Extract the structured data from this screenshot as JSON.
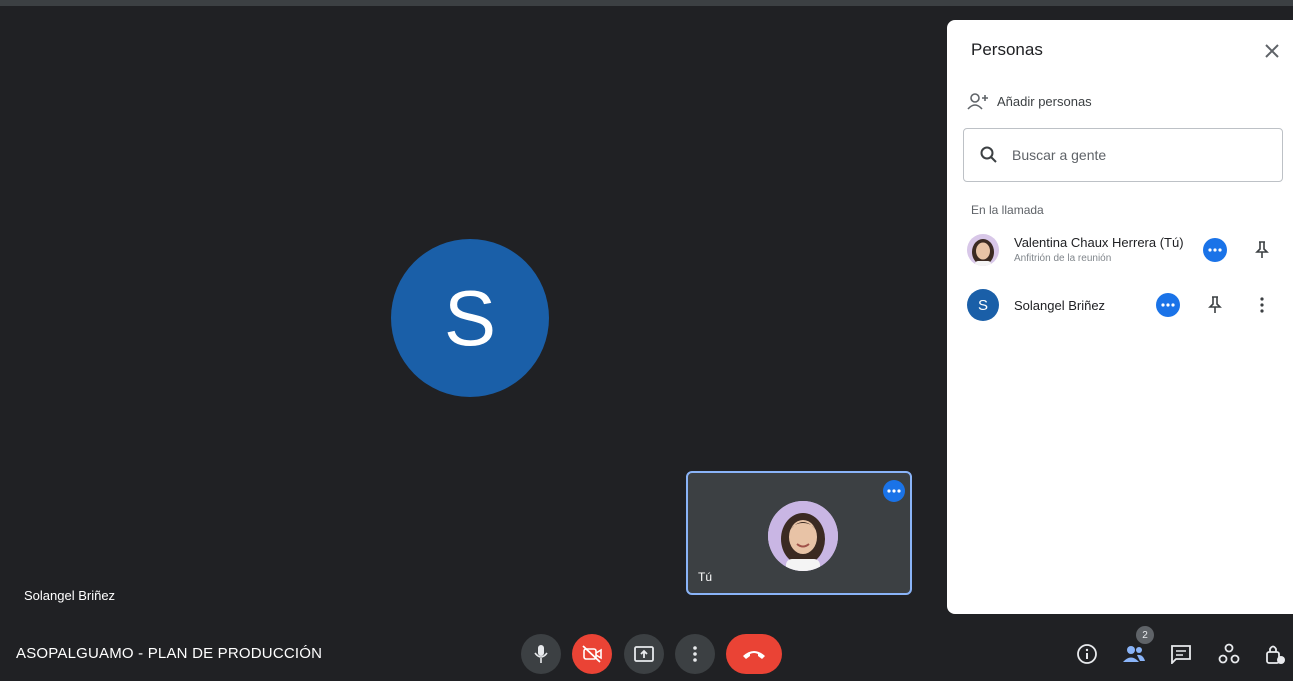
{
  "stage": {
    "main_participant_initial": "S",
    "main_participant_name": "Solangel Briñez",
    "self_tile_label": "Tú"
  },
  "panel": {
    "title": "Personas",
    "add_people_label": "Añadir personas",
    "search_placeholder": "Buscar a gente",
    "section_label": "En la llamada",
    "participants": [
      {
        "name": "Valentina Chaux Herrera (Tú)",
        "subtitle": "Anfitrión de la reunión",
        "avatar": "photo"
      },
      {
        "name": "Solangel Briñez",
        "subtitle": "",
        "avatar_initial": "S"
      }
    ]
  },
  "bottom_bar": {
    "meeting_name": "ASOPALGUAMO - PLAN DE PRODUCCIÓN",
    "people_count": "2"
  },
  "icons": {
    "controls": [
      "mic-icon",
      "camera-off-icon",
      "present-screen-icon",
      "more-options-icon",
      "hang-up-icon"
    ],
    "right": [
      "info-icon",
      "people-icon",
      "chat-icon",
      "activities-icon",
      "host-controls-icon"
    ]
  },
  "colors": {
    "background": "#202124",
    "avatar_blue": "#1a5fa8",
    "accent_blue": "#1a73e8",
    "danger_red": "#ea4335",
    "highlight_border": "#8ab4f8"
  }
}
